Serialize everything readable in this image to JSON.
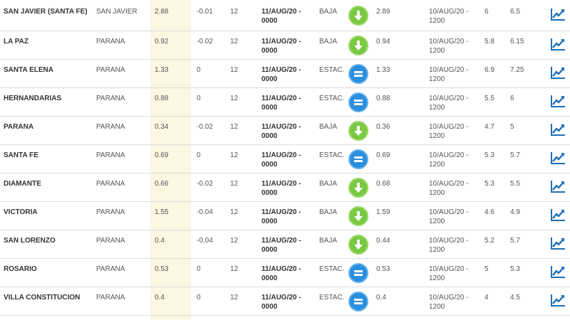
{
  "colors": {
    "highlight": "#fdf6e3",
    "down": "#7ac943",
    "equal": "#2b8fde",
    "chart_icon": "#1e6fb8"
  },
  "icons": {
    "down": "arrow-down-icon",
    "equal": "equals-icon",
    "chart": "line-chart-icon"
  },
  "rows": [
    {
      "station": "SAN JAVIER (SANTA FE)",
      "river": "SAN JAVIER",
      "level": "2.88",
      "variation": "-0.01",
      "freq": "12",
      "date1a": "11/AUG/20 -",
      "date1b": "0000",
      "trend": "BAJA",
      "trend_type": "down",
      "prev": "2.89",
      "date2a": "10/AUG/20 -",
      "date2b": "1200",
      "alert": "6",
      "evac": "6.5"
    },
    {
      "station": "LA PAZ",
      "river": "PARANA",
      "level": "0.92",
      "variation": "-0.02",
      "freq": "12",
      "date1a": "11/AUG/20 -",
      "date1b": "0000",
      "trend": "BAJA",
      "trend_type": "down",
      "prev": "0.94",
      "date2a": "10/AUG/20 -",
      "date2b": "1200",
      "alert": "5.8",
      "evac": "6.15"
    },
    {
      "station": "SANTA ELENA",
      "river": "PARANA",
      "level": "1.33",
      "variation": "0",
      "freq": "12",
      "date1a": "11/AUG/20 -",
      "date1b": "0000",
      "trend": "ESTAC.",
      "trend_type": "equal",
      "prev": "1.33",
      "date2a": "10/AUG/20 -",
      "date2b": "1200",
      "alert": "6.9",
      "evac": "7.25"
    },
    {
      "station": "HERNANDARIAS",
      "river": "PARANA",
      "level": "0.88",
      "variation": "0",
      "freq": "12",
      "date1a": "11/AUG/20 -",
      "date1b": "0000",
      "trend": "ESTAC.",
      "trend_type": "equal",
      "prev": "0.88",
      "date2a": "10/AUG/20 -",
      "date2b": "1200",
      "alert": "5.5",
      "evac": "6"
    },
    {
      "station": "PARANA",
      "river": "PARANA",
      "level": "0.34",
      "variation": "-0.02",
      "freq": "12",
      "date1a": "11/AUG/20 -",
      "date1b": "0000",
      "trend": "BAJA",
      "trend_type": "down",
      "prev": "0.36",
      "date2a": "10/AUG/20 -",
      "date2b": "1200",
      "alert": "4.7",
      "evac": "5"
    },
    {
      "station": "SANTA FE",
      "river": "PARANA",
      "level": "0.69",
      "variation": "0",
      "freq": "12",
      "date1a": "11/AUG/20 -",
      "date1b": "0000",
      "trend": "ESTAC.",
      "trend_type": "equal",
      "prev": "0.69",
      "date2a": "10/AUG/20 -",
      "date2b": "1200",
      "alert": "5.3",
      "evac": "5.7"
    },
    {
      "station": "DIAMANTE",
      "river": "PARANA",
      "level": "0.66",
      "variation": "-0.02",
      "freq": "12",
      "date1a": "11/AUG/20 -",
      "date1b": "0000",
      "trend": "BAJA",
      "trend_type": "down",
      "prev": "0.68",
      "date2a": "10/AUG/20 -",
      "date2b": "1200",
      "alert": "5.3",
      "evac": "5.5"
    },
    {
      "station": "VICTORIA",
      "river": "PARANA",
      "level": "1.55",
      "variation": "-0.04",
      "freq": "12",
      "date1a": "11/AUG/20 -",
      "date1b": "0000",
      "trend": "BAJA",
      "trend_type": "down",
      "prev": "1.59",
      "date2a": "10/AUG/20 -",
      "date2b": "1200",
      "alert": "4.6",
      "evac": "4.9"
    },
    {
      "station": "SAN LORENZO",
      "river": "PARANA",
      "level": "0.4",
      "variation": "-0.04",
      "freq": "12",
      "date1a": "11/AUG/20 -",
      "date1b": "0000",
      "trend": "BAJA",
      "trend_type": "down",
      "prev": "0.44",
      "date2a": "10/AUG/20 -",
      "date2b": "1200",
      "alert": "5.2",
      "evac": "5.7"
    },
    {
      "station": "ROSARIO",
      "river": "PARANA",
      "level": "0.53",
      "variation": "0",
      "freq": "12",
      "date1a": "11/AUG/20 -",
      "date1b": "0000",
      "trend": "ESTAC.",
      "trend_type": "equal",
      "prev": "0.53",
      "date2a": "10/AUG/20 -",
      "date2b": "1200",
      "alert": "5",
      "evac": "5.3"
    },
    {
      "station": "VILLA CONSTITUCION",
      "river": "PARANA",
      "level": "0.4",
      "variation": "0",
      "freq": "12",
      "date1a": "11/AUG/20 -",
      "date1b": "0000",
      "trend": "ESTAC.",
      "trend_type": "equal",
      "prev": "0.4",
      "date2a": "10/AUG/20 -",
      "date2b": "1200",
      "alert": "4",
      "evac": "4.5"
    }
  ]
}
